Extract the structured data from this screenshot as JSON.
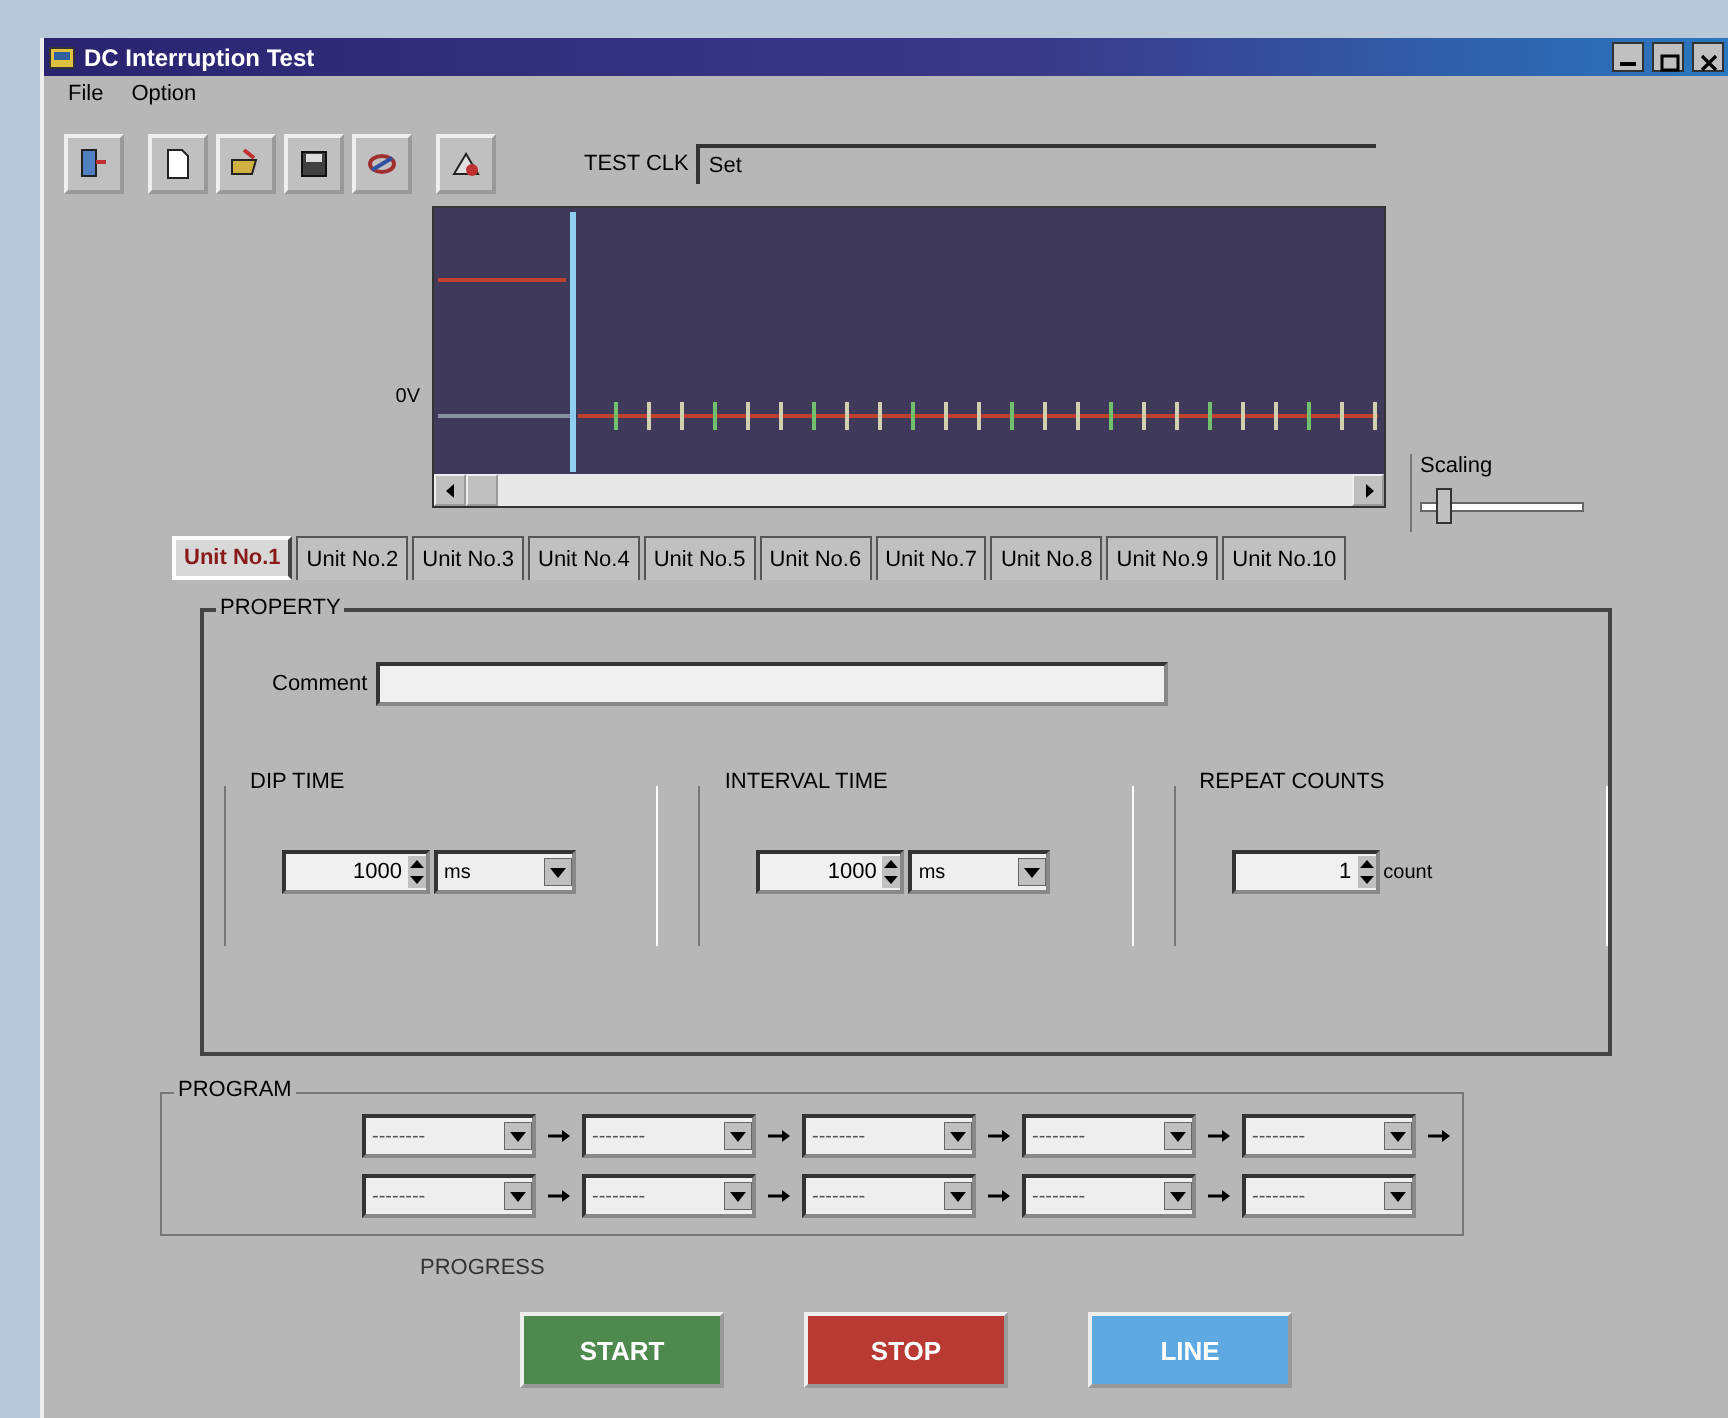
{
  "window": {
    "title": "DC Interruption Test"
  },
  "menu": [
    "File",
    "Option"
  ],
  "toolbar": [
    {
      "kind": "exit"
    },
    {
      "kind": "new"
    },
    {
      "kind": "open"
    },
    {
      "kind": "save"
    },
    {
      "kind": "link"
    },
    {
      "kind": "print"
    }
  ],
  "test_clk": {
    "label": "TEST CLK",
    "value": "Set"
  },
  "chart": {
    "axis_label": "0V",
    "scale_label": "Scaling",
    "scale": {
      "level": 0.1
    }
  },
  "tabs": [
    {
      "label": "Unit No.1",
      "selected": true
    },
    {
      "label": "Unit No.2",
      "selected": false
    },
    {
      "label": "Unit No.3",
      "selected": false
    },
    {
      "label": "Unit No.4",
      "selected": false
    },
    {
      "label": "Unit No.5",
      "selected": false
    },
    {
      "label": "Unit No.6",
      "selected": false
    },
    {
      "label": "Unit No.7",
      "selected": false
    },
    {
      "label": "Unit No.8",
      "selected": false
    },
    {
      "label": "Unit No.9",
      "selected": false
    },
    {
      "label": "Unit No.10",
      "selected": false
    }
  ],
  "property": {
    "title": "PROPERTY",
    "comment_label": "Comment",
    "groups": [
      {
        "title": "DIP TIME",
        "value": "1000",
        "unit": "ms",
        "kind": "dropdown"
      },
      {
        "title": "INTERVAL TIME",
        "value": "1000",
        "unit": "ms",
        "kind": "dropdown"
      },
      {
        "title": "REPEAT COUNTS",
        "value": "1",
        "unit": "count",
        "kind": "label"
      }
    ]
  },
  "program": {
    "title": "PROGRAM",
    "rows": [
      {
        "slots": [
          "--------",
          "--------",
          "--------",
          "--------",
          "--------"
        ],
        "continues": true
      },
      {
        "slots": [
          "--------",
          "--------",
          "--------",
          "--------",
          "--------"
        ],
        "continues": false
      }
    ]
  },
  "progress_label": "PROGRESS",
  "buttons": [
    {
      "label": "START",
      "color": "#4e8a4e"
    },
    {
      "label": "STOP",
      "color": "#b83a32"
    },
    {
      "label": "LINE",
      "color": "#5fa9e2"
    }
  ]
}
